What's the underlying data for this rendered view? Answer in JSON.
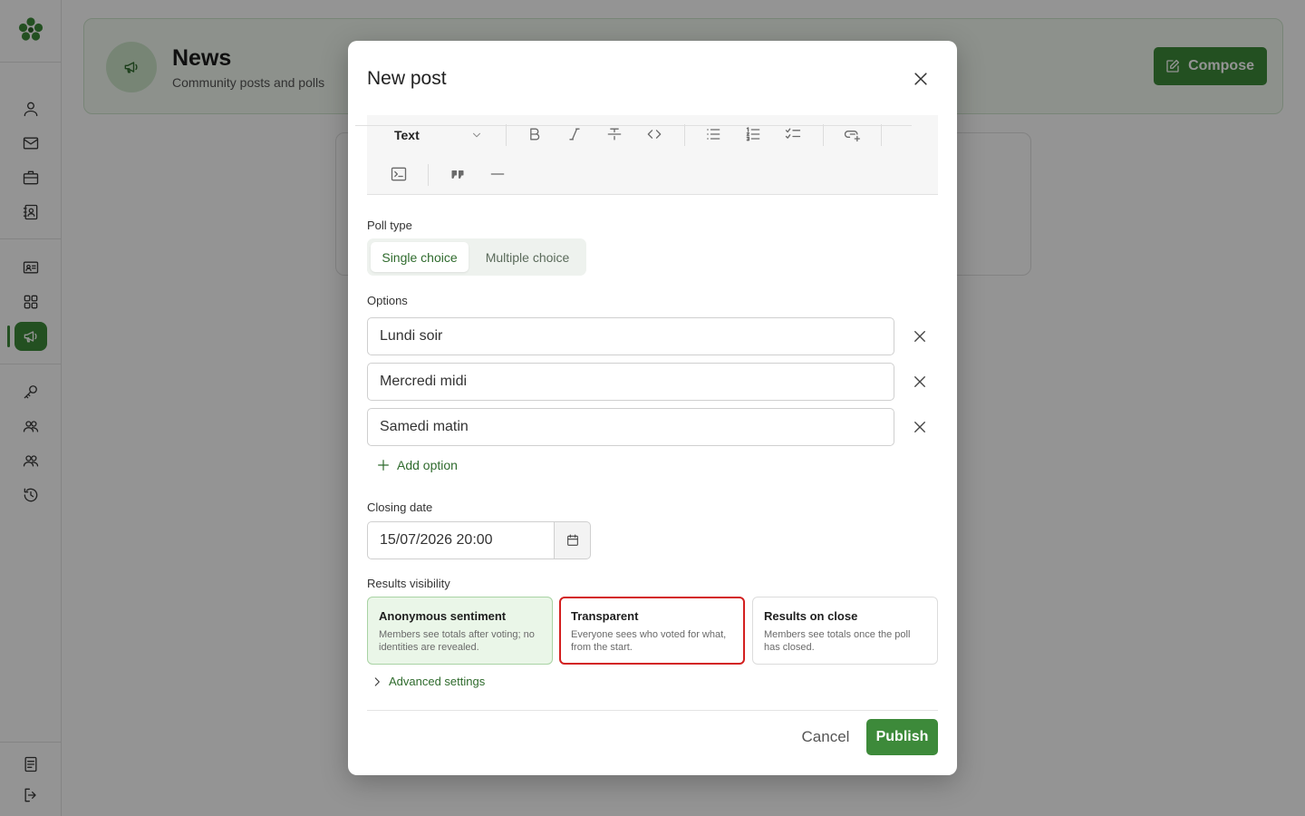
{
  "header": {
    "title": "News",
    "subtitle": "Community posts and polls",
    "compose_label": "Compose"
  },
  "sidebar": {
    "items": [
      {
        "icon": "user-icon"
      },
      {
        "icon": "mail-icon"
      },
      {
        "icon": "briefcase-icon"
      },
      {
        "icon": "contact-book-icon"
      },
      {
        "icon": "id-card-icon"
      },
      {
        "icon": "grid-icon"
      },
      {
        "icon": "megaphone-icon",
        "active": true
      },
      {
        "icon": "key-icon"
      },
      {
        "icon": "group-icon"
      },
      {
        "icon": "team-icon"
      },
      {
        "icon": "history-icon"
      },
      {
        "icon": "document-icon"
      },
      {
        "icon": "logout-icon"
      }
    ]
  },
  "modal": {
    "title": "New post",
    "toolbar": {
      "format_label": "Text"
    },
    "poll_type": {
      "label": "Poll type",
      "single": "Single choice",
      "multiple": "Multiple choice",
      "selected": "single"
    },
    "options": {
      "label": "Options",
      "items": [
        "Lundi soir",
        "Mercredi midi",
        "Samedi matin"
      ],
      "add_label": "Add option"
    },
    "closing": {
      "label": "Closing date",
      "value": "15/07/2026 20:00"
    },
    "visibility": {
      "label": "Results visibility",
      "cards": [
        {
          "title": "Anonymous sentiment",
          "desc": "Members see totals after voting; no identities are revealed."
        },
        {
          "title": "Transparent",
          "desc": "Everyone sees who voted for what, from the start."
        },
        {
          "title": "Results on close",
          "desc": "Members see totals once the poll has closed."
        }
      ]
    },
    "advanced_label": "Advanced settings",
    "cancel_label": "Cancel",
    "publish_label": "Publish"
  },
  "colors": {
    "accent": "#3d8a3a",
    "accent_light": "#eaf6e8",
    "focus_ring": "#d32020"
  }
}
